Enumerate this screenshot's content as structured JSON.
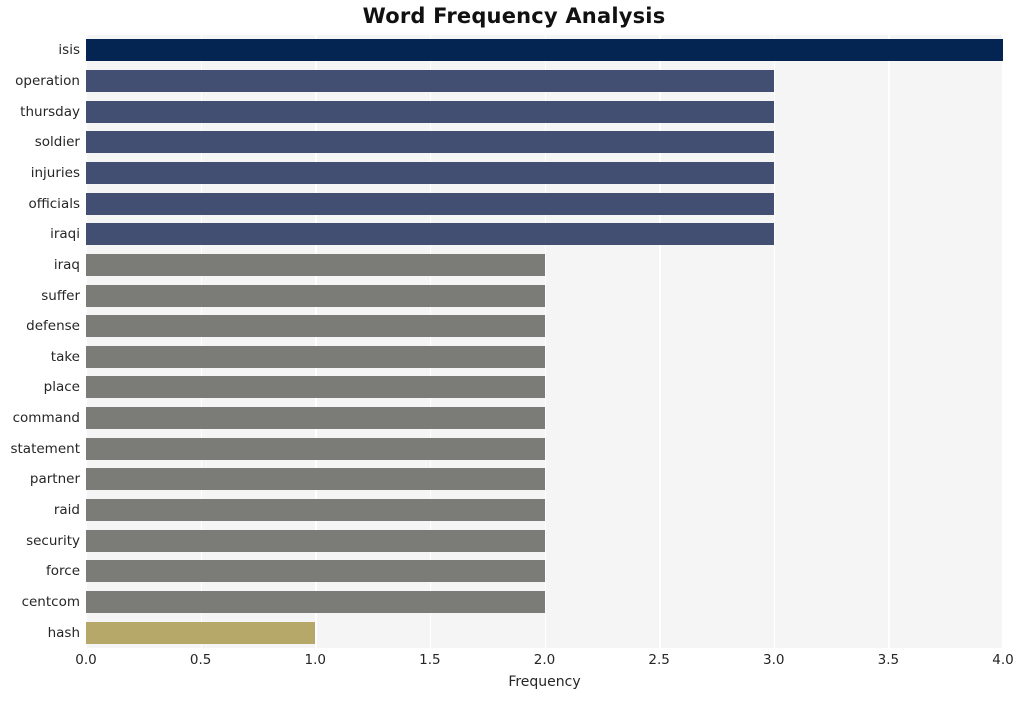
{
  "chart_data": {
    "type": "bar",
    "orientation": "horizontal",
    "title": "Word Frequency Analysis",
    "xlabel": "Frequency",
    "ylabel": "",
    "xlim": [
      0.0,
      4.0
    ],
    "xticks": [
      "0.0",
      "0.5",
      "1.0",
      "1.5",
      "2.0",
      "2.5",
      "3.0",
      "3.5",
      "4.0"
    ],
    "xtick_values": [
      0.0,
      0.5,
      1.0,
      1.5,
      2.0,
      2.5,
      3.0,
      3.5,
      4.0
    ],
    "grid": true,
    "grid_axis": "x",
    "grid_color": "#ffffff",
    "plot_background": "#f5f5f5",
    "figure_background": "#ffffff",
    "legend": null,
    "categories": [
      "isis",
      "operation",
      "thursday",
      "soldier",
      "injuries",
      "officials",
      "iraqi",
      "iraq",
      "suffer",
      "defense",
      "take",
      "place",
      "command",
      "statement",
      "partner",
      "raid",
      "security",
      "force",
      "centcom",
      "hash"
    ],
    "values": [
      4,
      3,
      3,
      3,
      3,
      3,
      3,
      2,
      2,
      2,
      2,
      2,
      2,
      2,
      2,
      2,
      2,
      2,
      2,
      1
    ],
    "bar_colors": [
      "#042552",
      "#434f72",
      "#434f72",
      "#434f72",
      "#434f72",
      "#434f72",
      "#434f72",
      "#7b7b78",
      "#7b7b78",
      "#7b7b78",
      "#7b7b78",
      "#7b7b78",
      "#7b7b78",
      "#7b7b78",
      "#7b7b78",
      "#7b7b78",
      "#7b7b78",
      "#7b7b78",
      "#7b7b78",
      "#b6a868"
    ]
  }
}
